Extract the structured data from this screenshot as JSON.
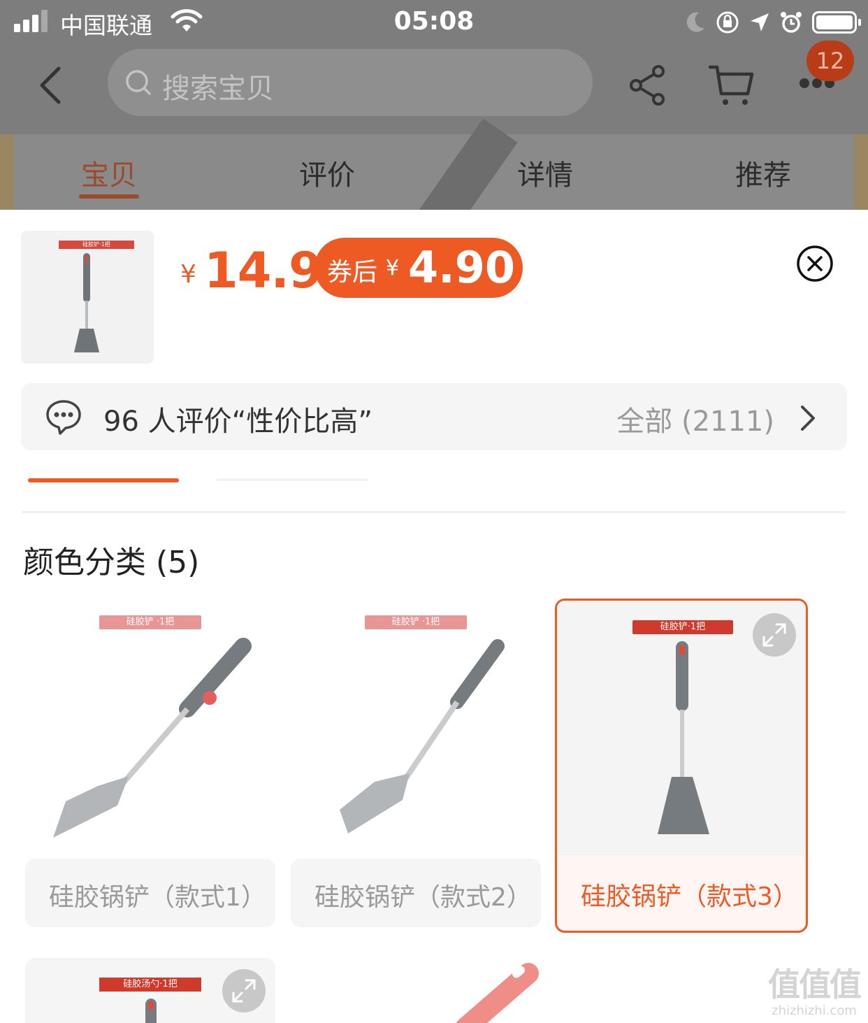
{
  "status_bar": {
    "carrier": "中国联通",
    "time": "05:08"
  },
  "nav": {
    "search_placeholder": "搜索宝贝",
    "cart_badge": "12"
  },
  "tabs": [
    {
      "label": "宝贝",
      "active": true
    },
    {
      "label": "评价",
      "active": false
    },
    {
      "label": "详情",
      "active": false
    },
    {
      "label": "推荐",
      "active": false
    }
  ],
  "product": {
    "thumb_tag": "硅胶铲·1把",
    "currency": "¥",
    "price": "14.9",
    "coupon_label": "券后",
    "coupon_currency": "¥",
    "coupon_price": "4.90"
  },
  "review": {
    "text": "96 人评价“性价比高”",
    "all": "全部 (2111)"
  },
  "section": {
    "title": "颜色分类 (5)"
  },
  "variants": [
    {
      "tag": "硅胶铲 ·1把",
      "label": "硅胶锅铲（款式1）",
      "selected": false
    },
    {
      "tag": "硅胶铲 ·1把",
      "label": "硅胶锅铲（款式2）",
      "selected": false
    },
    {
      "tag": "硅胶铲·1把",
      "label": "硅胶锅铲（款式3）",
      "selected": true
    },
    {
      "tag": "硅胶汤勺·1把",
      "label": "",
      "selected": false
    }
  ],
  "watermark": {
    "logo": "值值值",
    "url": "zhizhizhi.com"
  },
  "colors": {
    "accent": "#ee5a24",
    "selected_tag": "#d03a2c"
  }
}
